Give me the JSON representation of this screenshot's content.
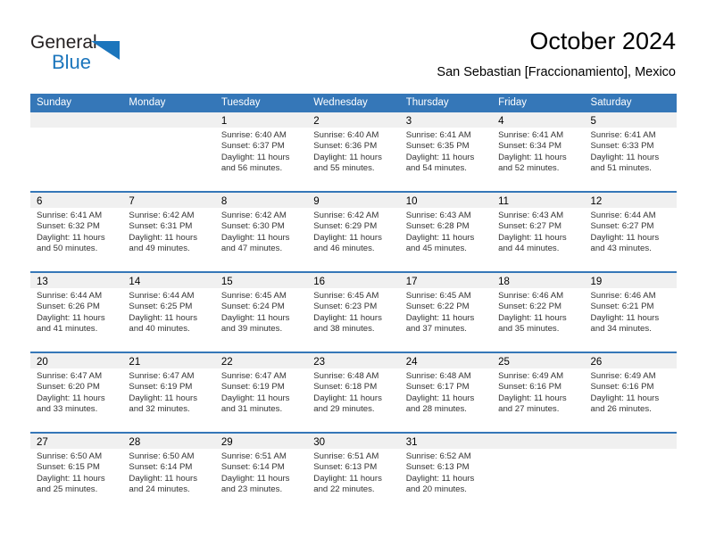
{
  "brand": {
    "logo_text_top": "General",
    "logo_text_bottom": "Blue",
    "accent_color": "#1b75bc",
    "logo_icon": "triangle-icon"
  },
  "header": {
    "month_title": "October 2024",
    "location": "San Sebastian [Fraccionamiento], Mexico"
  },
  "calendar": {
    "header_bg": "#3577b8",
    "day_band_bg": "#f0f0f0",
    "weekday_headers": [
      "Sunday",
      "Monday",
      "Tuesday",
      "Wednesday",
      "Thursday",
      "Friday",
      "Saturday"
    ],
    "weeks": [
      [
        {
          "day": "",
          "sunrise": "",
          "sunset": "",
          "daylight_line1": "",
          "daylight_line2": ""
        },
        {
          "day": "",
          "sunrise": "",
          "sunset": "",
          "daylight_line1": "",
          "daylight_line2": ""
        },
        {
          "day": "1",
          "sunrise": "Sunrise: 6:40 AM",
          "sunset": "Sunset: 6:37 PM",
          "daylight_line1": "Daylight: 11 hours",
          "daylight_line2": "and 56 minutes."
        },
        {
          "day": "2",
          "sunrise": "Sunrise: 6:40 AM",
          "sunset": "Sunset: 6:36 PM",
          "daylight_line1": "Daylight: 11 hours",
          "daylight_line2": "and 55 minutes."
        },
        {
          "day": "3",
          "sunrise": "Sunrise: 6:41 AM",
          "sunset": "Sunset: 6:35 PM",
          "daylight_line1": "Daylight: 11 hours",
          "daylight_line2": "and 54 minutes."
        },
        {
          "day": "4",
          "sunrise": "Sunrise: 6:41 AM",
          "sunset": "Sunset: 6:34 PM",
          "daylight_line1": "Daylight: 11 hours",
          "daylight_line2": "and 52 minutes."
        },
        {
          "day": "5",
          "sunrise": "Sunrise: 6:41 AM",
          "sunset": "Sunset: 6:33 PM",
          "daylight_line1": "Daylight: 11 hours",
          "daylight_line2": "and 51 minutes."
        }
      ],
      [
        {
          "day": "6",
          "sunrise": "Sunrise: 6:41 AM",
          "sunset": "Sunset: 6:32 PM",
          "daylight_line1": "Daylight: 11 hours",
          "daylight_line2": "and 50 minutes."
        },
        {
          "day": "7",
          "sunrise": "Sunrise: 6:42 AM",
          "sunset": "Sunset: 6:31 PM",
          "daylight_line1": "Daylight: 11 hours",
          "daylight_line2": "and 49 minutes."
        },
        {
          "day": "8",
          "sunrise": "Sunrise: 6:42 AM",
          "sunset": "Sunset: 6:30 PM",
          "daylight_line1": "Daylight: 11 hours",
          "daylight_line2": "and 47 minutes."
        },
        {
          "day": "9",
          "sunrise": "Sunrise: 6:42 AM",
          "sunset": "Sunset: 6:29 PM",
          "daylight_line1": "Daylight: 11 hours",
          "daylight_line2": "and 46 minutes."
        },
        {
          "day": "10",
          "sunrise": "Sunrise: 6:43 AM",
          "sunset": "Sunset: 6:28 PM",
          "daylight_line1": "Daylight: 11 hours",
          "daylight_line2": "and 45 minutes."
        },
        {
          "day": "11",
          "sunrise": "Sunrise: 6:43 AM",
          "sunset": "Sunset: 6:27 PM",
          "daylight_line1": "Daylight: 11 hours",
          "daylight_line2": "and 44 minutes."
        },
        {
          "day": "12",
          "sunrise": "Sunrise: 6:44 AM",
          "sunset": "Sunset: 6:27 PM",
          "daylight_line1": "Daylight: 11 hours",
          "daylight_line2": "and 43 minutes."
        }
      ],
      [
        {
          "day": "13",
          "sunrise": "Sunrise: 6:44 AM",
          "sunset": "Sunset: 6:26 PM",
          "daylight_line1": "Daylight: 11 hours",
          "daylight_line2": "and 41 minutes."
        },
        {
          "day": "14",
          "sunrise": "Sunrise: 6:44 AM",
          "sunset": "Sunset: 6:25 PM",
          "daylight_line1": "Daylight: 11 hours",
          "daylight_line2": "and 40 minutes."
        },
        {
          "day": "15",
          "sunrise": "Sunrise: 6:45 AM",
          "sunset": "Sunset: 6:24 PM",
          "daylight_line1": "Daylight: 11 hours",
          "daylight_line2": "and 39 minutes."
        },
        {
          "day": "16",
          "sunrise": "Sunrise: 6:45 AM",
          "sunset": "Sunset: 6:23 PM",
          "daylight_line1": "Daylight: 11 hours",
          "daylight_line2": "and 38 minutes."
        },
        {
          "day": "17",
          "sunrise": "Sunrise: 6:45 AM",
          "sunset": "Sunset: 6:22 PM",
          "daylight_line1": "Daylight: 11 hours",
          "daylight_line2": "and 37 minutes."
        },
        {
          "day": "18",
          "sunrise": "Sunrise: 6:46 AM",
          "sunset": "Sunset: 6:22 PM",
          "daylight_line1": "Daylight: 11 hours",
          "daylight_line2": "and 35 minutes."
        },
        {
          "day": "19",
          "sunrise": "Sunrise: 6:46 AM",
          "sunset": "Sunset: 6:21 PM",
          "daylight_line1": "Daylight: 11 hours",
          "daylight_line2": "and 34 minutes."
        }
      ],
      [
        {
          "day": "20",
          "sunrise": "Sunrise: 6:47 AM",
          "sunset": "Sunset: 6:20 PM",
          "daylight_line1": "Daylight: 11 hours",
          "daylight_line2": "and 33 minutes."
        },
        {
          "day": "21",
          "sunrise": "Sunrise: 6:47 AM",
          "sunset": "Sunset: 6:19 PM",
          "daylight_line1": "Daylight: 11 hours",
          "daylight_line2": "and 32 minutes."
        },
        {
          "day": "22",
          "sunrise": "Sunrise: 6:47 AM",
          "sunset": "Sunset: 6:19 PM",
          "daylight_line1": "Daylight: 11 hours",
          "daylight_line2": "and 31 minutes."
        },
        {
          "day": "23",
          "sunrise": "Sunrise: 6:48 AM",
          "sunset": "Sunset: 6:18 PM",
          "daylight_line1": "Daylight: 11 hours",
          "daylight_line2": "and 29 minutes."
        },
        {
          "day": "24",
          "sunrise": "Sunrise: 6:48 AM",
          "sunset": "Sunset: 6:17 PM",
          "daylight_line1": "Daylight: 11 hours",
          "daylight_line2": "and 28 minutes."
        },
        {
          "day": "25",
          "sunrise": "Sunrise: 6:49 AM",
          "sunset": "Sunset: 6:16 PM",
          "daylight_line1": "Daylight: 11 hours",
          "daylight_line2": "and 27 minutes."
        },
        {
          "day": "26",
          "sunrise": "Sunrise: 6:49 AM",
          "sunset": "Sunset: 6:16 PM",
          "daylight_line1": "Daylight: 11 hours",
          "daylight_line2": "and 26 minutes."
        }
      ],
      [
        {
          "day": "27",
          "sunrise": "Sunrise: 6:50 AM",
          "sunset": "Sunset: 6:15 PM",
          "daylight_line1": "Daylight: 11 hours",
          "daylight_line2": "and 25 minutes."
        },
        {
          "day": "28",
          "sunrise": "Sunrise: 6:50 AM",
          "sunset": "Sunset: 6:14 PM",
          "daylight_line1": "Daylight: 11 hours",
          "daylight_line2": "and 24 minutes."
        },
        {
          "day": "29",
          "sunrise": "Sunrise: 6:51 AM",
          "sunset": "Sunset: 6:14 PM",
          "daylight_line1": "Daylight: 11 hours",
          "daylight_line2": "and 23 minutes."
        },
        {
          "day": "30",
          "sunrise": "Sunrise: 6:51 AM",
          "sunset": "Sunset: 6:13 PM",
          "daylight_line1": "Daylight: 11 hours",
          "daylight_line2": "and 22 minutes."
        },
        {
          "day": "31",
          "sunrise": "Sunrise: 6:52 AM",
          "sunset": "Sunset: 6:13 PM",
          "daylight_line1": "Daylight: 11 hours",
          "daylight_line2": "and 20 minutes."
        },
        {
          "day": "",
          "sunrise": "",
          "sunset": "",
          "daylight_line1": "",
          "daylight_line2": ""
        },
        {
          "day": "",
          "sunrise": "",
          "sunset": "",
          "daylight_line1": "",
          "daylight_line2": ""
        }
      ]
    ]
  }
}
